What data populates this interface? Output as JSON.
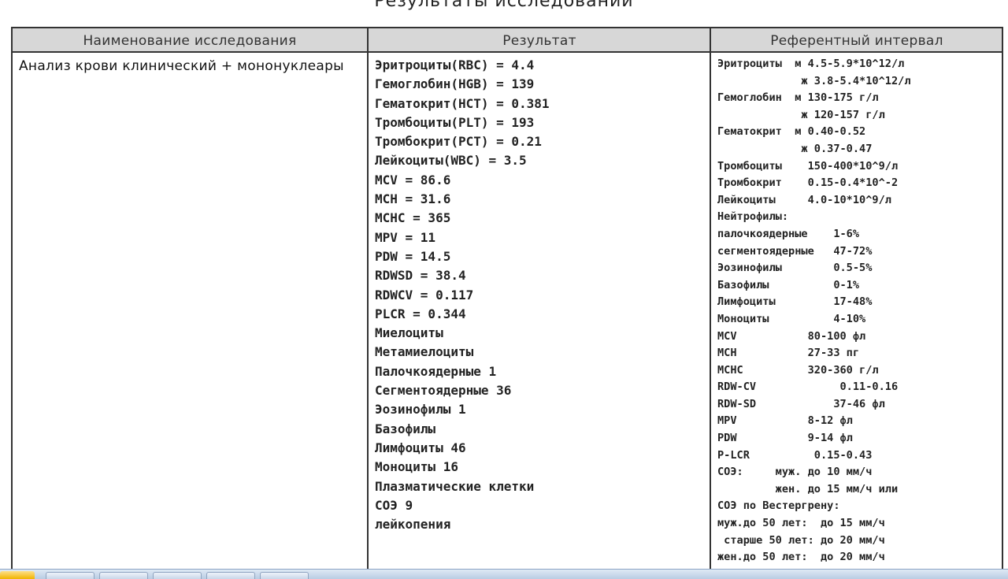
{
  "title": "Результаты исследований",
  "table": {
    "headers": {
      "name": "Наименование исследования",
      "result": "Результат",
      "reference": "Референтный интервал"
    },
    "test_name": "Анализ крови клинический + мононуклеары",
    "results": [
      "Эритроциты(RBC) = 4.4",
      "Гемоглобин(HGB) = 139",
      "Гематокрит(HCT) = 0.381",
      "Тромбоциты(PLT) = 193",
      "Тромбокрит(PCT) = 0.21",
      "Лейкоциты(WBC) = 3.5",
      "MCV = 86.6",
      "MCH = 31.6",
      "MCHC = 365",
      "MPV = 11",
      "PDW = 14.5",
      "RDWSD = 38.4",
      "RDWCV = 0.117",
      "PLCR = 0.344",
      "Миелоциты",
      "Метамиелоциты",
      "Палочкоядерные 1",
      "Сегментоядерные 36",
      "Эозинофилы 1",
      "Базофилы",
      "Лимфоциты 46",
      "Моноциты 16",
      "Плазматические клетки",
      "СОЭ 9",
      "лейкопения"
    ],
    "reference": [
      "Эритроциты  м 4.5-5.9*10^12/л",
      "             ж 3.8-5.4*10^12/л",
      "Гемоглобин  м 130-175 г/л",
      "             ж 120-157 г/л",
      "Гематокрит  м 0.40-0.52",
      "             ж 0.37-0.47",
      "Тромбоциты    150-400*10^9/л",
      "Тромбокрит    0.15-0.4*10^-2",
      "Лейкоциты     4.0-10*10^9/л",
      "Нейтрофилы:",
      "палочкоядерные    1-6%",
      "сегментоядерные   47-72%",
      "Эозинофилы        0.5-5%",
      "Базофилы          0-1%",
      "Лимфоциты         17-48%",
      "Моноциты          4-10%",
      "MCV           80-100 фл",
      "MCH           27-33 пг",
      "MCHC          320-360 г/л",
      "RDW-CV             0.11-0.16",
      "RDW-SD            37-46 фл",
      "MPV           8-12 фл",
      "PDW           9-14 фл",
      "P-LCR          0.15-0.43",
      "СОЭ:     муж. до 10 мм/ч",
      "         жен. до 15 мм/ч или",
      "СОЭ по Вестергрену:",
      "муж.до 50 лет:  до 15 мм/ч",
      " старше 50 лет: до 20 мм/ч",
      "жен.до 50 лет:  до 20 мм/ч"
    ]
  }
}
